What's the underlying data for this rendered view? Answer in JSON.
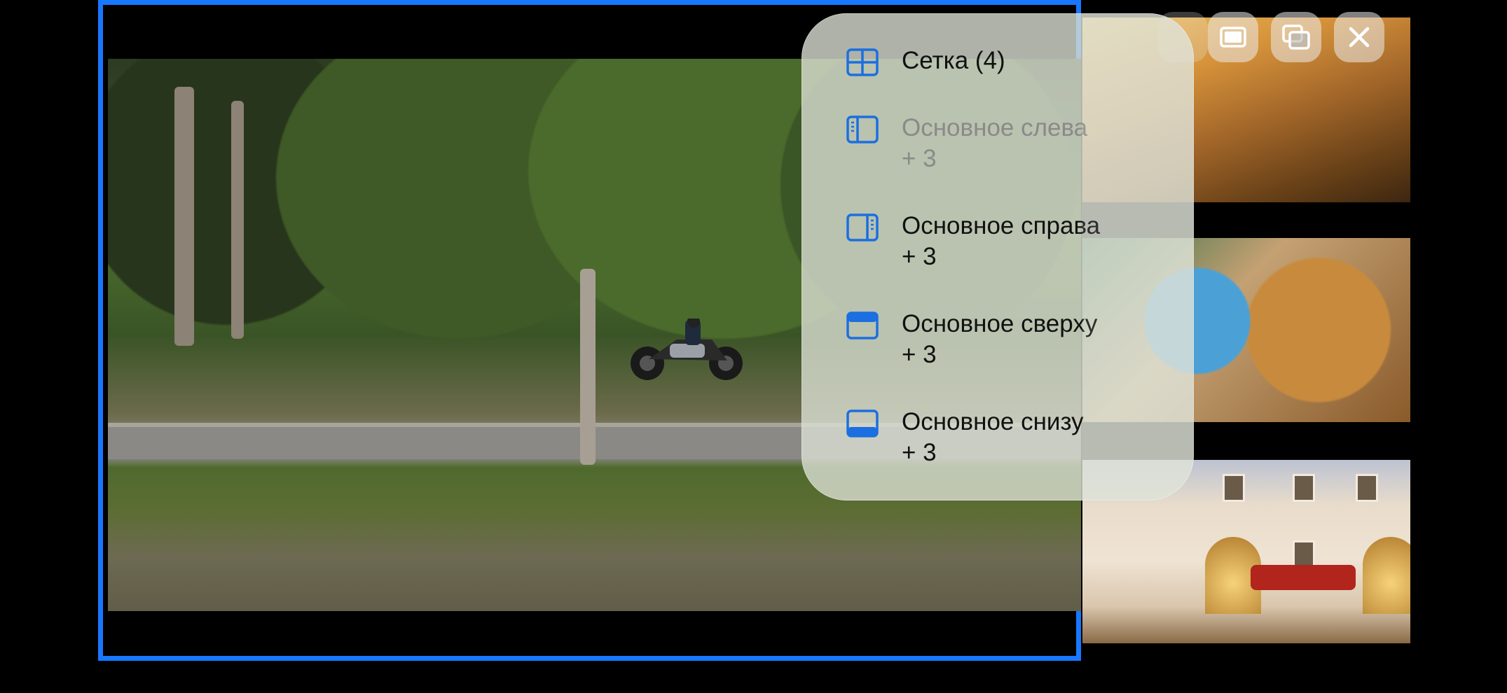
{
  "layout_menu": {
    "items": [
      {
        "icon": "grid-icon",
        "line1": "Сетка (4)",
        "line2": "",
        "enabled": true
      },
      {
        "icon": "sidebar-left-icon",
        "line1": "Основное слева",
        "line2": "+ 3",
        "enabled": false
      },
      {
        "icon": "sidebar-right-icon",
        "line1": "Основное справа",
        "line2": "+ 3",
        "enabled": true
      },
      {
        "icon": "panel-top-icon",
        "line1": "Основное сверху",
        "line2": "+ 3",
        "enabled": true
      },
      {
        "icon": "panel-bottom-icon",
        "line1": "Основное снизу",
        "line2": "+ 3",
        "enabled": true
      }
    ]
  },
  "window_controls": [
    "fullscreen-icon",
    "picture-in-picture-icon",
    "close-icon"
  ],
  "colors": {
    "accent_blue": "#1778ff",
    "menu_background": "rgba(218,222,210,0.80)",
    "text_primary": "#111111",
    "text_disabled": "#8a8a8a"
  }
}
